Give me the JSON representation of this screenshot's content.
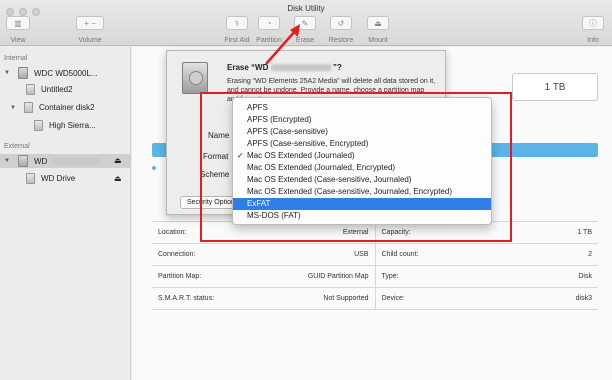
{
  "window": {
    "title": "Disk Utility"
  },
  "toolbar": {
    "view_label": "View",
    "volume_label": "Volume",
    "first_aid_label": "First Aid",
    "partition_label": "Partition",
    "erase_label": "Erase",
    "restore_label": "Restore",
    "mount_label": "Mount",
    "info_label": "Info"
  },
  "sidebar": {
    "internal_header": "Internal",
    "external_header": "External",
    "items": [
      {
        "label": "WDC WD5000L..."
      },
      {
        "label": "Untitled2"
      },
      {
        "label": "Container disk2"
      },
      {
        "label": "High Sierra..."
      },
      {
        "label": "WD"
      },
      {
        "label": "WD Drive"
      }
    ]
  },
  "main": {
    "capacity_box": "1 TB"
  },
  "erase_sheet": {
    "title_prefix": "Erase “WD",
    "title_suffix": "”?",
    "description": "Erasing “WD Elements 25A2 Media” will delete all data stored on it, and cannot be undone. Provide a name, choose a partition map and format.",
    "name_label": "Name",
    "format_label": "Format",
    "scheme_label": "Scheme",
    "security_button": "Security Options..."
  },
  "format_menu": {
    "selected_index": 4,
    "highlighted_index": 8,
    "options": [
      "APFS",
      "APFS (Encrypted)",
      "APFS (Case-sensitive)",
      "APFS (Case-sensitive, Encrypted)",
      "Mac OS Extended (Journaled)",
      "Mac OS Extended (Journaled, Encrypted)",
      "Mac OS Extended (Case-sensitive, Journaled)",
      "Mac OS Extended (Case-sensitive, Journaled, Encrypted)",
      "ExFAT",
      "MS-DOS (FAT)"
    ]
  },
  "info_table": {
    "rows": [
      [
        {
          "label": "Location:",
          "value": "External"
        },
        {
          "label": "Capacity:",
          "value": "1 TB"
        }
      ],
      [
        {
          "label": "Connection:",
          "value": "USB"
        },
        {
          "label": "Child count:",
          "value": "2"
        }
      ],
      [
        {
          "label": "Partition Map:",
          "value": "GUID Partition Map"
        },
        {
          "label": "Type:",
          "value": "Disk"
        }
      ],
      [
        {
          "label": "S.M.A.R.T. status:",
          "value": "Not Supported"
        },
        {
          "label": "Device:",
          "value": "disk3"
        }
      ]
    ]
  },
  "colors": {
    "accent_blue": "#2f7ee6",
    "usage_bar": "#5ab5e6",
    "annotation_red": "#e02020"
  }
}
